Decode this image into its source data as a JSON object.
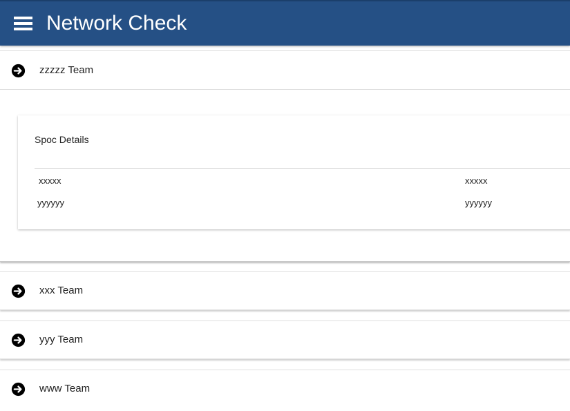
{
  "app": {
    "title": "Network Check",
    "menu_icon": "hamburger-menu-icon",
    "header_color": "#255085"
  },
  "teams": [
    {
      "label": "zzzzz Team",
      "icon": "arrow-circle-right-icon",
      "expanded": true
    },
    {
      "label": "xxx Team",
      "icon": "arrow-circle-right-icon",
      "expanded": false
    },
    {
      "label": "yyy Team",
      "icon": "arrow-circle-right-icon",
      "expanded": false
    },
    {
      "label": "www Team",
      "icon": "arrow-circle-right-icon",
      "expanded": false
    }
  ],
  "spoc_card": {
    "title": "Spoc Details",
    "rows": [
      [
        "xxxxx",
        "xxxxx"
      ],
      [
        "yyyyyy",
        "yyyyyy"
      ]
    ]
  }
}
